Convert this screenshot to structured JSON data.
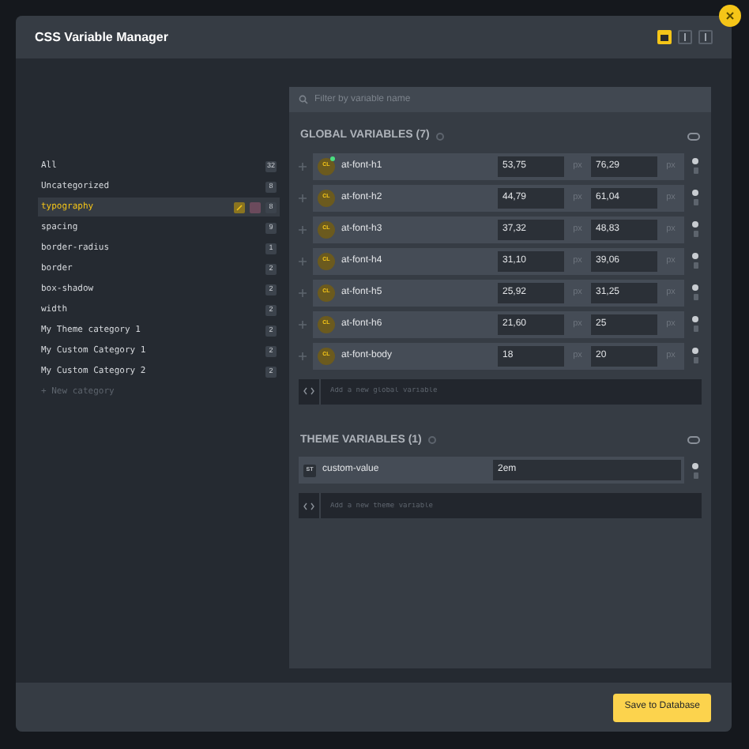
{
  "window": {
    "title": "CSS Variable Manager"
  },
  "view_modes": [
    {
      "selected": true
    },
    {
      "selected": false
    },
    {
      "selected": false
    }
  ],
  "categories": [
    {
      "label": "All",
      "count": "32",
      "selected": false
    },
    {
      "label": "Uncategorized",
      "count": "8",
      "selected": false
    },
    {
      "label": "typography",
      "count": "8",
      "selected": true
    },
    {
      "label": "spacing",
      "count": "9",
      "selected": false
    },
    {
      "label": "border-radius",
      "count": "1",
      "selected": false
    },
    {
      "label": "border",
      "count": "2",
      "selected": false
    },
    {
      "label": "box-shadow",
      "count": "2",
      "selected": false
    },
    {
      "label": "width",
      "count": "2",
      "selected": false
    },
    {
      "label": "My Theme category 1",
      "count": "2",
      "selected": false
    },
    {
      "label": "My Custom Category 1",
      "count": "2",
      "selected": false
    },
    {
      "label": "My Custom Category 2",
      "count": "2",
      "selected": false
    }
  ],
  "new_category": "+ New category",
  "search": {
    "placeholder": "Filter by variable name"
  },
  "sections": [
    {
      "title": "GLOBAL VARIABLES (7)",
      "add_placeholder": "Add a new global variable",
      "variables": [
        {
          "kind": "clamp",
          "badge": "CL",
          "name": "at-font-h1",
          "min": "53,75",
          "min_unit": "px",
          "max": "76,29",
          "max_unit": "px",
          "modified": true
        },
        {
          "kind": "clamp",
          "badge": "CL",
          "name": "at-font-h2",
          "min": "44,79",
          "min_unit": "px",
          "max": "61,04",
          "max_unit": "px",
          "modified": false
        },
        {
          "kind": "clamp",
          "badge": "CL",
          "name": "at-font-h3",
          "min": "37,32",
          "min_unit": "px",
          "max": "48,83",
          "max_unit": "px",
          "modified": false
        },
        {
          "kind": "clamp",
          "badge": "CL",
          "name": "at-font-h4",
          "min": "31,10",
          "min_unit": "px",
          "max": "39,06",
          "max_unit": "px",
          "modified": false
        },
        {
          "kind": "clamp",
          "badge": "CL",
          "name": "at-font-h5",
          "min": "25,92",
          "min_unit": "px",
          "max": "31,25",
          "max_unit": "px",
          "modified": false
        },
        {
          "kind": "clamp",
          "badge": "CL",
          "name": "at-font-h6",
          "min": "21,60",
          "min_unit": "px",
          "max": "25",
          "max_unit": "px",
          "modified": false
        },
        {
          "kind": "clamp",
          "badge": "CL",
          "name": "at-font-body",
          "min": "18",
          "min_unit": "px",
          "max": "20",
          "max_unit": "px",
          "modified": false
        }
      ]
    },
    {
      "title": "THEME VARIABLES (1)",
      "add_placeholder": "Add a new theme variable",
      "variables": [
        {
          "kind": "static",
          "badge": "ST",
          "name": "custom-value",
          "value": "2em"
        }
      ]
    }
  ],
  "save_button": "Save to Database"
}
